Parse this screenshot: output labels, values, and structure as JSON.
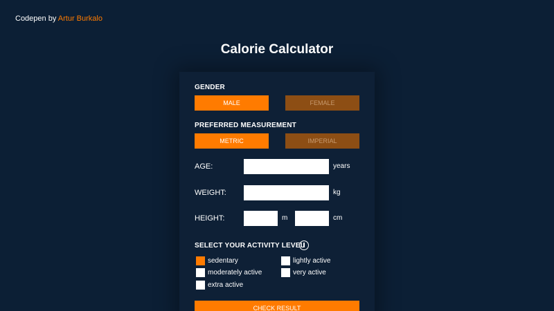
{
  "credit": {
    "prefix": "Codepen by ",
    "author": "Artur Burkalo"
  },
  "title": "Calorie Calculator",
  "gender": {
    "label": "GENDER",
    "options": [
      "MALE",
      "FEMALE"
    ],
    "selected": "MALE"
  },
  "measurement": {
    "label": "PREFERRED MEASUREMENT",
    "options": [
      "METRIC",
      "IMPERIAL"
    ],
    "selected": "METRIC"
  },
  "fields": {
    "age": {
      "label": "AGE:",
      "value": "",
      "unit": "years"
    },
    "weight": {
      "label": "WEIGHT:",
      "value": "",
      "unit": "kg"
    },
    "height": {
      "label": "HEIGHT:",
      "value_m": "",
      "unit_m": "m",
      "value_cm": "",
      "unit_cm": "cm"
    }
  },
  "activity": {
    "label": "SELECT YOUR ACTIVITY LEVEL",
    "info_icon": "info-icon",
    "options": [
      {
        "label": "sedentary",
        "checked": true
      },
      {
        "label": "lightly active",
        "checked": false
      },
      {
        "label": "moderately active",
        "checked": false
      },
      {
        "label": "very active",
        "checked": false
      },
      {
        "label": "extra active",
        "checked": false
      }
    ]
  },
  "submit_label": "CHECK RESULT",
  "colors": {
    "accent": "#ff7b00",
    "background": "#0c1f35",
    "inactive_button": "#8d4e14"
  }
}
